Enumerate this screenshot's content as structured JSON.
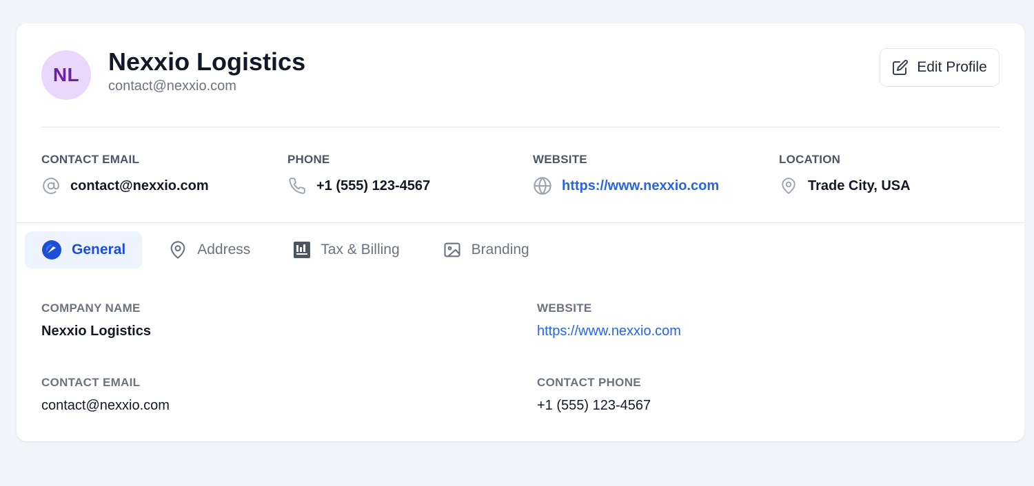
{
  "profile": {
    "initials": "NL",
    "name": "Nexxio Logistics",
    "email": "contact@nexxio.com",
    "edit_label": "Edit Profile"
  },
  "info": [
    {
      "label": "CONTACT EMAIL",
      "value": "contact@nexxio.com",
      "icon": "at-sign-icon"
    },
    {
      "label": "PHONE",
      "value": "+1 (555) 123-4567",
      "icon": "phone-icon"
    },
    {
      "label": "WEBSITE",
      "value": "https://www.nexxio.com",
      "icon": "globe-icon"
    },
    {
      "label": "LOCATION",
      "value": "Trade City, USA",
      "icon": "map-pin-icon"
    }
  ],
  "tabs": [
    {
      "label": "General",
      "icon": "general-icon",
      "active": true
    },
    {
      "label": "Address",
      "icon": "map-pin-icon",
      "active": false
    },
    {
      "label": "Tax & Billing",
      "icon": "billing-chart-icon",
      "active": false
    },
    {
      "label": "Branding",
      "icon": "image-icon",
      "active": false
    }
  ],
  "general": {
    "company_name_label": "COMPANY NAME",
    "company_name": "Nexxio Logistics",
    "website_label": "WEBSITE",
    "website": "https://www.nexxio.com",
    "contact_email_label": "CONTACT EMAIL",
    "contact_email": "contact@nexxio.com",
    "contact_phone_label": "CONTACT PHONE",
    "contact_phone": "+1 (555) 123-4567"
  },
  "colors": {
    "accent": "#2563eb",
    "avatar_bg": "#ead7fb",
    "avatar_text": "#6b21a8",
    "active_tab_bg": "#eef4ff",
    "page_bg": "#f1f4f8"
  }
}
